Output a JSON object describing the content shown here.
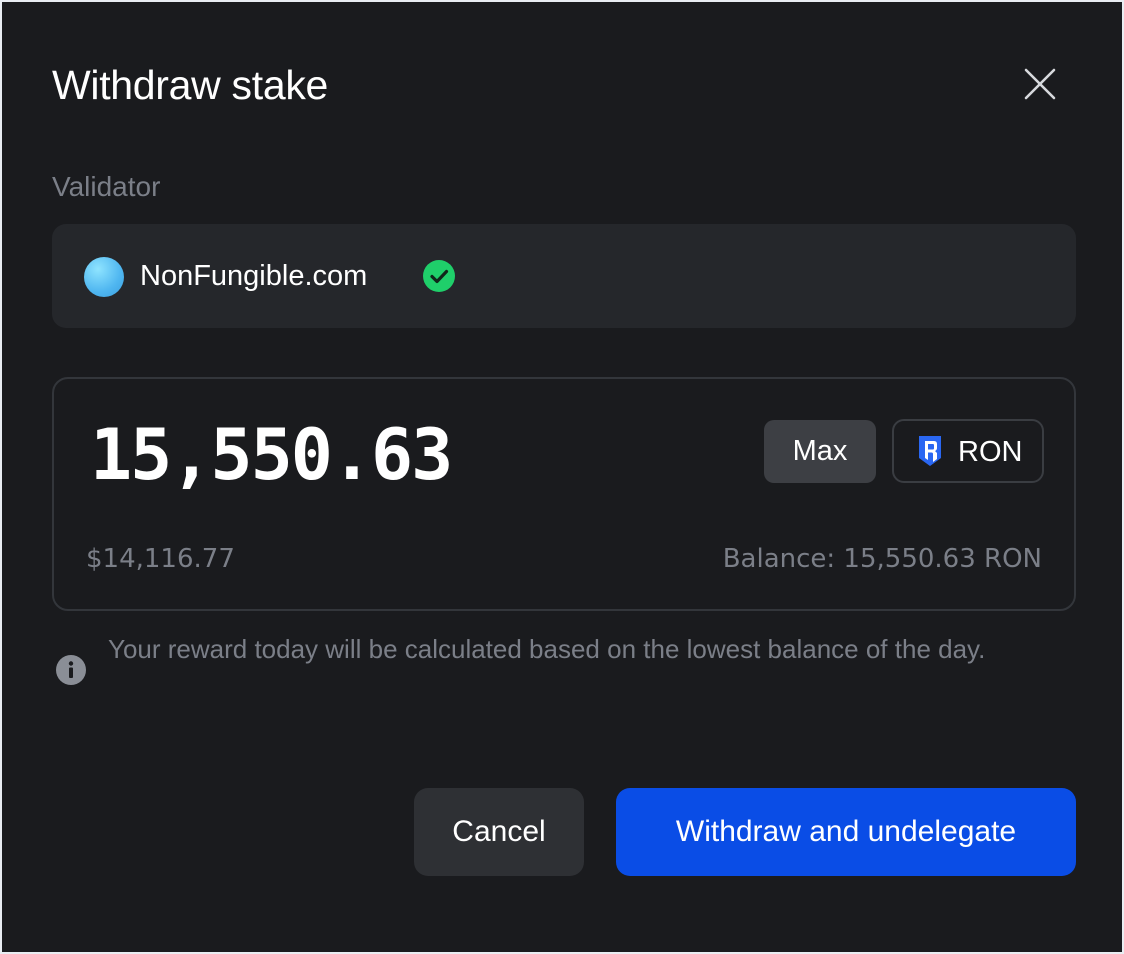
{
  "modal": {
    "title": "Withdraw stake",
    "close_icon": "close-icon"
  },
  "validator": {
    "label": "Validator",
    "name": "NonFungible.com",
    "verified_icon": "check-circle-icon",
    "avatar_color": "#4fb6f0",
    "verified_color": "#1fcf6a"
  },
  "amount": {
    "value": "15,550.63",
    "usd_value": "$14,116.77",
    "balance": "Balance: 15,550.63 RON",
    "max_label": "Max",
    "token_label": "RON",
    "token_icon": "ronin-shield-icon",
    "token_color": "#2a67f2"
  },
  "info": {
    "icon": "info-icon",
    "text": "Your reward today will be calculated based on the lowest balance of the day."
  },
  "actions": {
    "cancel_label": "Cancel",
    "submit_label": "Withdraw and undelegate",
    "submit_color": "#0a4de6"
  }
}
